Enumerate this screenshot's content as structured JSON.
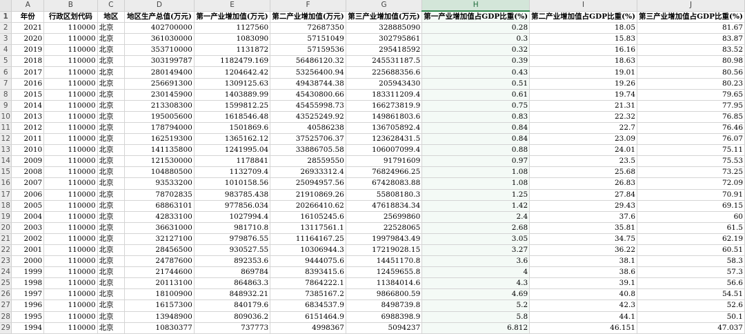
{
  "grid": {
    "column_letters": [
      "A",
      "B",
      "C",
      "D",
      "E",
      "F",
      "G",
      "H",
      "I",
      "J"
    ],
    "selected_column": "H",
    "headers": [
      "年份",
      "行政区划代码",
      "地区",
      "地区生产总值(万元)",
      "第一产业增加值(万元)",
      "第二产业增加值(万元)",
      "第三产业增加值(万元)",
      "第一产业增加值占GDP比重(%)",
      "第二产业增加值占GDP比重(%)",
      "第三产业增加值占GDP比重(%)"
    ],
    "rows": [
      [
        "2021",
        "110000",
        "北京",
        "402700000",
        "1127560",
        "72687350",
        "328885090",
        "0.28",
        "18.05",
        "81.67"
      ],
      [
        "2020",
        "110000",
        "北京",
        "361030000",
        "1083090",
        "57151049",
        "302795861",
        "0.3",
        "15.83",
        "83.87"
      ],
      [
        "2019",
        "110000",
        "北京",
        "353710000",
        "1131872",
        "57159536",
        "295418592",
        "0.32",
        "16.16",
        "83.52"
      ],
      [
        "2018",
        "110000",
        "北京",
        "303199787",
        "1182479.169",
        "56486120.32",
        "245531187.5",
        "0.39",
        "18.63",
        "80.98"
      ],
      [
        "2017",
        "110000",
        "北京",
        "280149400",
        "1204642.42",
        "53256400.94",
        "225688356.6",
        "0.43",
        "19.01",
        "80.56"
      ],
      [
        "2016",
        "110000",
        "北京",
        "256691300",
        "1309125.63",
        "49438744.38",
        "205943430",
        "0.51",
        "19.26",
        "80.23"
      ],
      [
        "2015",
        "110000",
        "北京",
        "230145900",
        "1403889.99",
        "45430800.66",
        "183311209.4",
        "0.61",
        "19.74",
        "79.65"
      ],
      [
        "2014",
        "110000",
        "北京",
        "213308300",
        "1599812.25",
        "45455998.73",
        "166273819.9",
        "0.75",
        "21.31",
        "77.95"
      ],
      [
        "2013",
        "110000",
        "北京",
        "195005600",
        "1618546.48",
        "43525249.92",
        "149861803.6",
        "0.83",
        "22.32",
        "76.85"
      ],
      [
        "2012",
        "110000",
        "北京",
        "178794000",
        "1501869.6",
        "40586238",
        "136705892.4",
        "0.84",
        "22.7",
        "76.46"
      ],
      [
        "2011",
        "110000",
        "北京",
        "162519300",
        "1365162.12",
        "37525706.37",
        "123628431.5",
        "0.84",
        "23.09",
        "76.07"
      ],
      [
        "2010",
        "110000",
        "北京",
        "141135800",
        "1241995.04",
        "33886705.58",
        "106007099.4",
        "0.88",
        "24.01",
        "75.11"
      ],
      [
        "2009",
        "110000",
        "北京",
        "121530000",
        "1178841",
        "28559550",
        "91791609",
        "0.97",
        "23.5",
        "75.53"
      ],
      [
        "2008",
        "110000",
        "北京",
        "104880500",
        "1132709.4",
        "26933312.4",
        "76824966.25",
        "1.08",
        "25.68",
        "73.25"
      ],
      [
        "2007",
        "110000",
        "北京",
        "93533200",
        "1010158.56",
        "25094957.56",
        "67428083.88",
        "1.08",
        "26.83",
        "72.09"
      ],
      [
        "2006",
        "110000",
        "北京",
        "78702835",
        "983785.438",
        "21910869.26",
        "55808180.3",
        "1.25",
        "27.84",
        "70.91"
      ],
      [
        "2005",
        "110000",
        "北京",
        "68863101",
        "977856.034",
        "20266410.62",
        "47618834.34",
        "1.42",
        "29.43",
        "69.15"
      ],
      [
        "2004",
        "110000",
        "北京",
        "42833100",
        "1027994.4",
        "16105245.6",
        "25699860",
        "2.4",
        "37.6",
        "60"
      ],
      [
        "2003",
        "110000",
        "北京",
        "36631000",
        "981710.8",
        "13117561.1",
        "22528065",
        "2.68",
        "35.81",
        "61.5"
      ],
      [
        "2002",
        "110000",
        "北京",
        "32127100",
        "979876.55",
        "11164167.25",
        "19979843.49",
        "3.05",
        "34.75",
        "62.19"
      ],
      [
        "2001",
        "110000",
        "北京",
        "28456500",
        "930527.55",
        "10306944.3",
        "17219028.15",
        "3.27",
        "36.22",
        "60.51"
      ],
      [
        "2000",
        "110000",
        "北京",
        "24787600",
        "892353.6",
        "9444075.6",
        "14451170.8",
        "3.6",
        "38.1",
        "58.3"
      ],
      [
        "1999",
        "110000",
        "北京",
        "21744600",
        "869784",
        "8393415.6",
        "12459655.8",
        "4",
        "38.6",
        "57.3"
      ],
      [
        "1998",
        "110000",
        "北京",
        "20113100",
        "864863.3",
        "7864222.1",
        "11384014.6",
        "4.3",
        "39.1",
        "56.6"
      ],
      [
        "1997",
        "110000",
        "北京",
        "18100900",
        "848932.21",
        "7385167.2",
        "9866800.59",
        "4.69",
        "40.8",
        "54.51"
      ],
      [
        "1996",
        "110000",
        "北京",
        "16157300",
        "840179.6",
        "6834537.9",
        "8498739.8",
        "5.2",
        "42.3",
        "52.6"
      ],
      [
        "1995",
        "110000",
        "北京",
        "13948900",
        "809036.2",
        "6151464.9",
        "6988398.9",
        "5.8",
        "44.1",
        "50.1"
      ],
      [
        "1994",
        "110000",
        "北京",
        "10830377",
        "737773",
        "4998367",
        "5094237",
        "6.812",
        "46.151",
        "47.037"
      ]
    ]
  }
}
